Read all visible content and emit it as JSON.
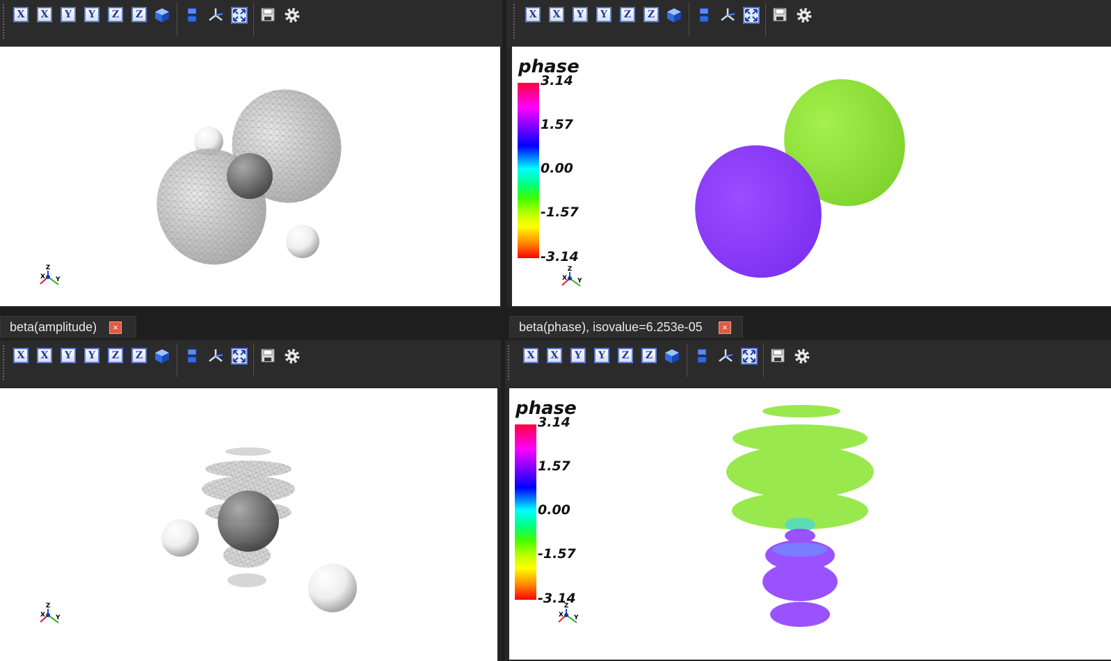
{
  "panes": {
    "top_left": {
      "viewport": {
        "view": "amplitude-isosurface"
      }
    },
    "top_right": {
      "viewport": {
        "colorbar": {
          "title": "phase",
          "ticks": [
            "3.14",
            "1.57",
            "0.00",
            "-1.57",
            "-3.14"
          ]
        }
      }
    },
    "bottom_left": {
      "tab": {
        "label": "beta(amplitude)",
        "close_glyph": "×"
      }
    },
    "bottom_right": {
      "tab": {
        "label": "beta(phase), isovalue=6.253e-05",
        "close_glyph": "×"
      },
      "viewport": {
        "colorbar": {
          "title": "phase",
          "ticks": [
            "3.14",
            "1.57",
            "0.00",
            "-1.57",
            "-3.14"
          ]
        }
      }
    }
  },
  "toolbar": {
    "buttons": [
      {
        "name": "view-x-plus-button",
        "label": "X"
      },
      {
        "name": "view-x-minus-button",
        "label": "X"
      },
      {
        "name": "view-y-plus-button",
        "label": "Y"
      },
      {
        "name": "view-y-minus-button",
        "label": "Y"
      },
      {
        "name": "view-z-plus-button",
        "label": "Z"
      },
      {
        "name": "view-z-minus-button",
        "label": "Z"
      },
      {
        "name": "view-isometric-button",
        "icon": "cube-icon"
      },
      {
        "name": "parallel-projection-button",
        "icon": "projection-icon"
      },
      {
        "name": "toggle-axes-button",
        "icon": "axes-icon"
      },
      {
        "name": "fit-view-button",
        "icon": "fit-view-icon"
      },
      {
        "name": "save-image-button",
        "icon": "save-icon"
      },
      {
        "name": "settings-button",
        "icon": "gear-icon"
      }
    ]
  },
  "triad": {
    "x": "X",
    "y": "Y",
    "z": "Z"
  },
  "colors": {
    "phase_purple": "#9040ff",
    "phase_green": "#8ee63a",
    "tab_close": "#e15a47",
    "axis_button_blue": "#1b3a9b"
  }
}
